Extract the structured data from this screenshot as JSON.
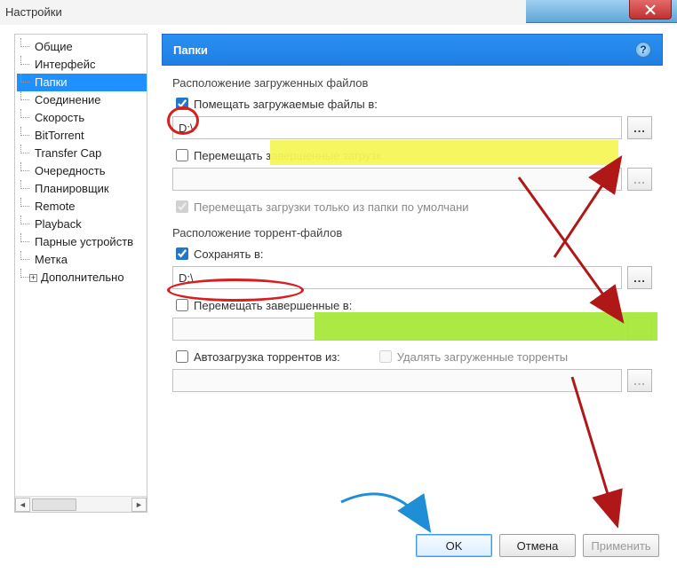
{
  "window": {
    "title": "Настройки"
  },
  "sidebar": {
    "items": [
      {
        "label": "Общие"
      },
      {
        "label": "Интерфейс"
      },
      {
        "label": "Папки",
        "selected": true
      },
      {
        "label": "Соединение"
      },
      {
        "label": "Скорость"
      },
      {
        "label": "BitTorrent"
      },
      {
        "label": "Transfer Cap"
      },
      {
        "label": "Очередность"
      },
      {
        "label": "Планировщик"
      },
      {
        "label": "Remote"
      },
      {
        "label": "Playback"
      },
      {
        "label": "Парные устройств"
      },
      {
        "label": "Метка"
      }
    ],
    "expander_label": "Дополнительно"
  },
  "header": {
    "title": "Папки"
  },
  "section1": {
    "title": "Расположение загруженных файлов",
    "chk1": "Помещать загружаемые файлы в:",
    "path1": "D:\\",
    "chk2": "Перемещать завершенные загрузк",
    "chk3": "Перемещать загрузки только из папки по умолчани"
  },
  "section2": {
    "title": "Расположение торрент-файлов",
    "chk1": "Сохранять в:",
    "path1": "D:\\",
    "chk2": "Перемещать завершенные в:",
    "chk3": "Автозагрузка торрентов из:",
    "chk4": "Удалять загруженные торренты"
  },
  "buttons": {
    "ok": "OK",
    "cancel": "Отмена",
    "apply": "Применить"
  },
  "browse_label": "..."
}
